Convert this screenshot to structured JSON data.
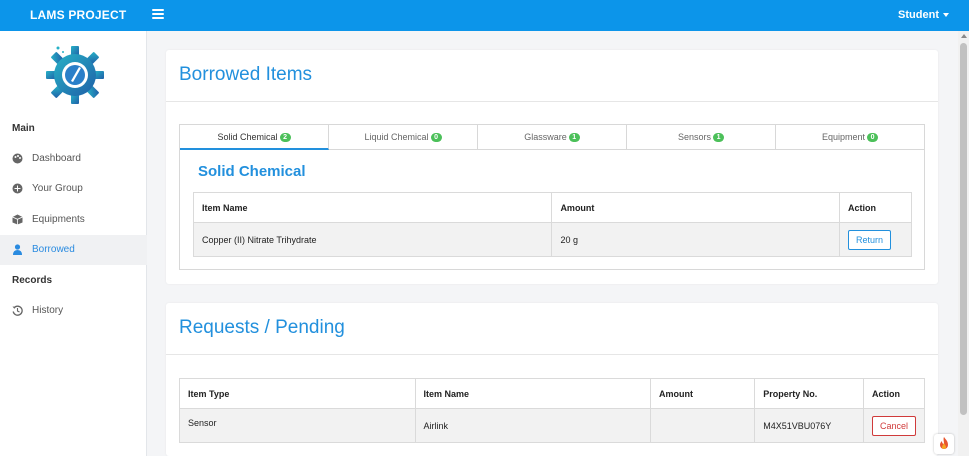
{
  "header": {
    "brand": "LAMS PROJECT",
    "user": "Student"
  },
  "sidebar": {
    "main_label": "Main",
    "records_label": "Records",
    "items": [
      {
        "label": "Dashboard",
        "icon": "palette-icon"
      },
      {
        "label": "Your Group",
        "icon": "plus-circle-icon"
      },
      {
        "label": "Equipments",
        "icon": "cube-icon"
      },
      {
        "label": "Borrowed",
        "icon": "user-icon",
        "active": true
      },
      {
        "label": "History",
        "icon": "history-icon"
      }
    ]
  },
  "borrowed": {
    "title": "Borrowed Items",
    "tabs": [
      {
        "label": "Solid Chemical",
        "count": "2",
        "active": true
      },
      {
        "label": "Liquid Chemical",
        "count": "0"
      },
      {
        "label": "Glassware",
        "count": "1"
      },
      {
        "label": "Sensors",
        "count": "1"
      },
      {
        "label": "Equipment",
        "count": "0"
      }
    ],
    "section_title": "Solid Chemical",
    "columns": [
      "Item Name",
      "Amount",
      "Action"
    ],
    "rows": [
      {
        "item_name": "Copper (II) Nitrate Trihydrate",
        "amount": "20 g",
        "action": "Return"
      }
    ]
  },
  "requests": {
    "title": "Requests / Pending",
    "columns": [
      "Item Type",
      "Item Name",
      "Amount",
      "Property No.",
      "Action"
    ],
    "rows": [
      {
        "item_type": "Sensor",
        "item_name": "Airlink",
        "amount": "",
        "property_no": "M4X51VBU076Y",
        "action": "Cancel"
      }
    ]
  },
  "colors": {
    "primary": "#0c95ea",
    "accent_text": "#2290dd",
    "badge": "#4cc05a",
    "danger": "#d03a3a"
  }
}
